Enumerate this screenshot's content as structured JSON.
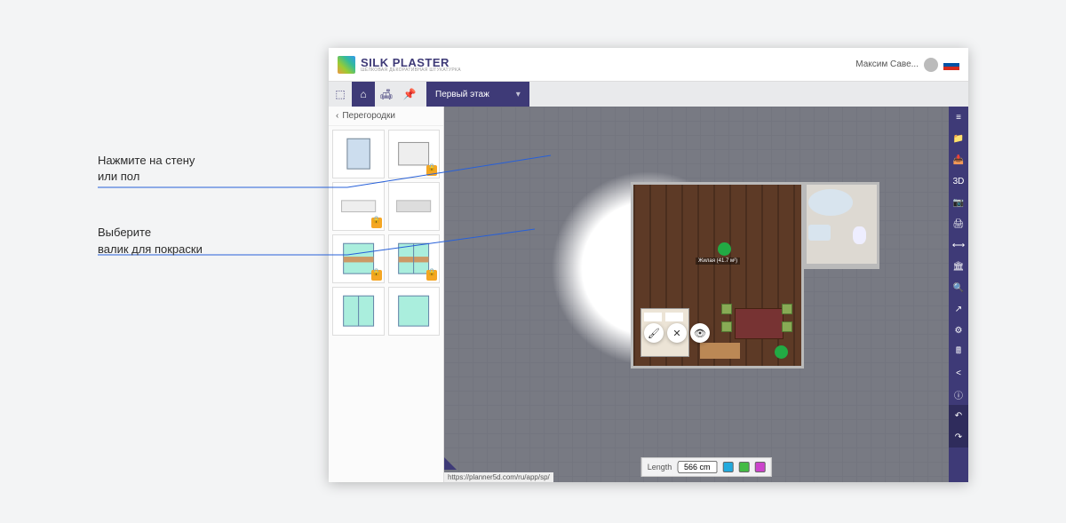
{
  "annotations": {
    "a1_l1": "Нажмите на стену",
    "a1_l2": "или пол",
    "a2_l1": "Выберите",
    "a2_l2": "валик для покраски"
  },
  "brand": {
    "title": "SILK PLASTER",
    "subtitle": "ШЁЛКОВАЯ ДЕКОРАТИВНАЯ ШТУКАТУРКА"
  },
  "user": {
    "name": "Максим Саве...",
    "locale": "ru"
  },
  "tool_tabs": {
    "room": "⌂",
    "furniture": "🛋",
    "decor": "📌",
    "shapes": "⬚"
  },
  "floor_selector": {
    "label": "Первый этаж"
  },
  "sidebar": {
    "back": "‹",
    "category": "Перегородки"
  },
  "room": {
    "label": "Жилая (41.7 м²)"
  },
  "context_tools": {
    "roller": "🖌",
    "close": "✕",
    "eye": "👁"
  },
  "right_rail": {
    "items": [
      "≡",
      "📁",
      "📥",
      "3D",
      "📷",
      "🖨",
      "⟷",
      "🏛",
      "🔍",
      "↗",
      "⚙",
      "🖩",
      "<",
      "ⓘ",
      "↶",
      "↷"
    ]
  },
  "bottom_bar": {
    "label": "Length",
    "value": "566 cm"
  },
  "status_url": "https://planner5d.com/ru/app/sp/"
}
